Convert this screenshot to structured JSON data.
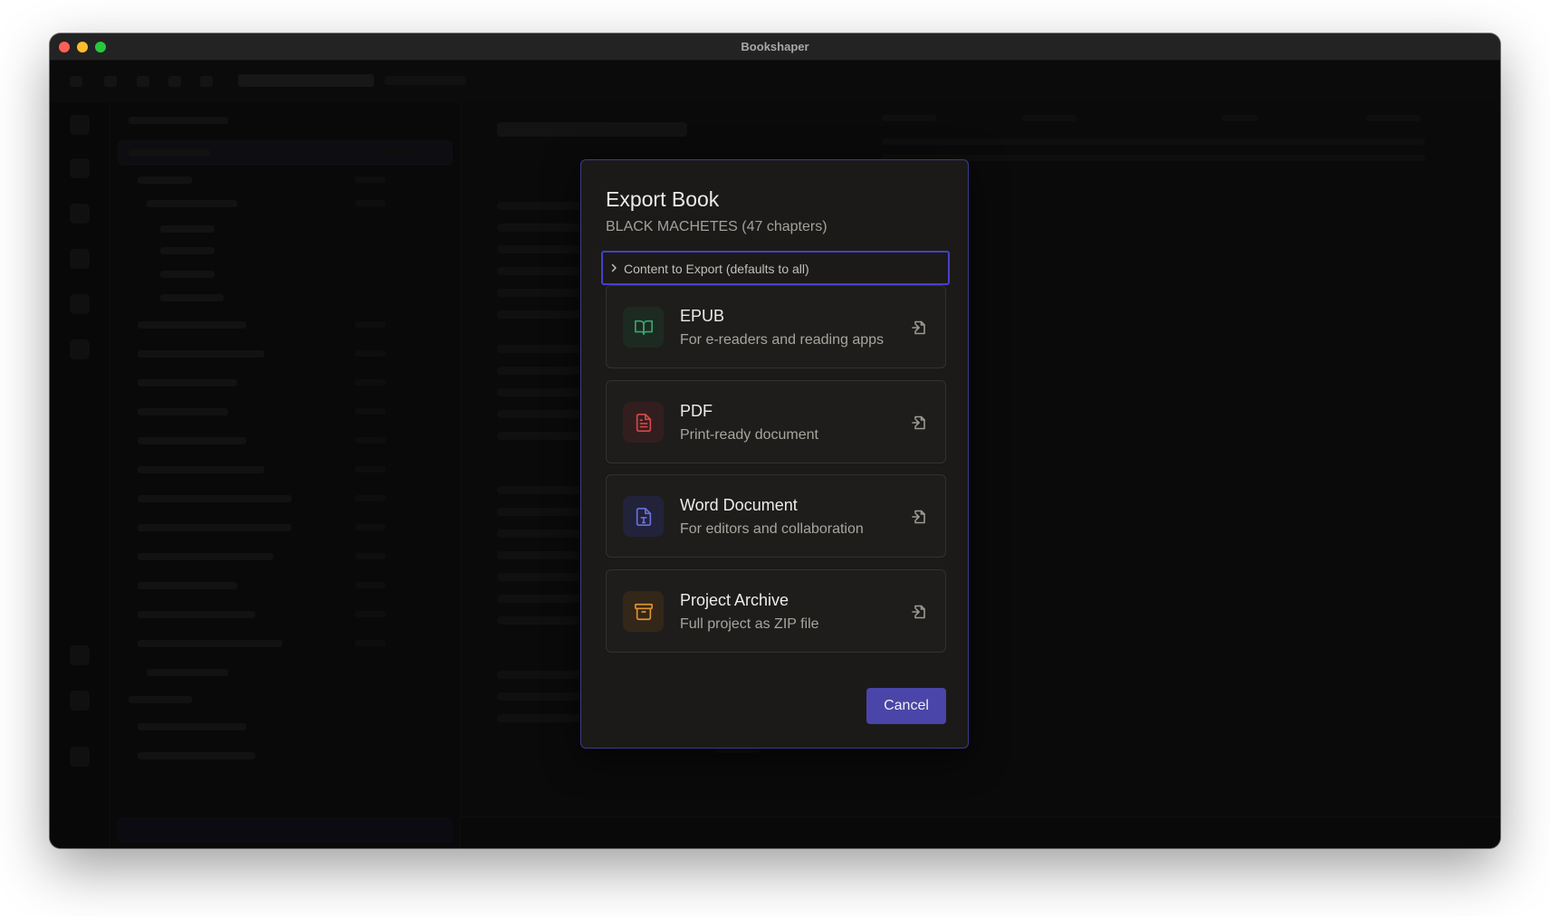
{
  "window": {
    "title": "Bookshaper"
  },
  "modal": {
    "title": "Export Book",
    "subtitle": "BLACK MACHETES (47 chapters)",
    "content_toggle_label": "Content to Export (defaults to all)",
    "options": [
      {
        "name": "EPUB",
        "description": "For e-readers and reading apps",
        "icon": "book-open-icon",
        "color": "#3aa56d",
        "bg": "#1c2a22"
      },
      {
        "name": "PDF",
        "description": "Print-ready document",
        "icon": "file-text-icon",
        "color": "#d84848",
        "bg": "#331e1f"
      },
      {
        "name": "Word Document",
        "description": "For editors and collaboration",
        "icon": "file-type-icon",
        "color": "#6a70e0",
        "bg": "#22233a"
      },
      {
        "name": "Project Archive",
        "description": "Full project as ZIP file",
        "icon": "archive-icon",
        "color": "#e0922e",
        "bg": "#33271a"
      }
    ],
    "export_icon": "export-arrow-icon",
    "cancel_label": "Cancel"
  },
  "colors": {
    "accent": "#4540c6",
    "cancel_button": "#4a45a8",
    "modal_bg": "#1b1a18"
  }
}
